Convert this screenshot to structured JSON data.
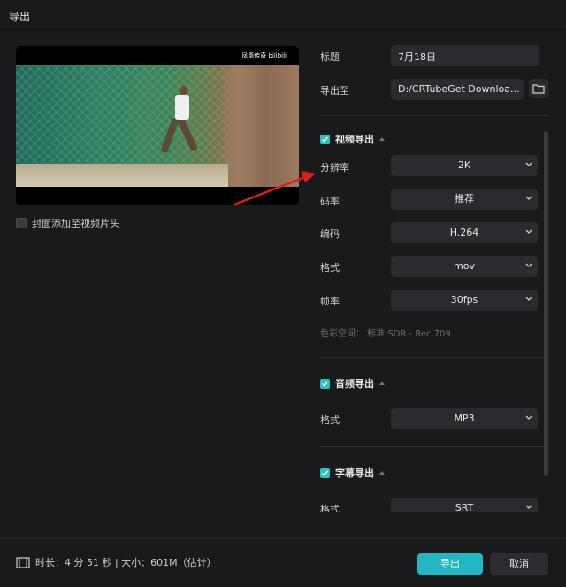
{
  "window": {
    "title": "导出"
  },
  "preview": {
    "watermark": "凤凰传奇 bilibili"
  },
  "cover": {
    "label": "封面添加至视频片头",
    "checked": false
  },
  "fields": {
    "title_label": "标题",
    "title_value": "7月18日",
    "export_to_label": "导出至",
    "export_to_value": "D:/CRTubeGet Downloa..."
  },
  "video": {
    "section_label": "视频导出",
    "checked": true,
    "resolution_label": "分辨率",
    "resolution_value": "2K",
    "bitrate_label": "码率",
    "bitrate_value": "推荐",
    "codec_label": "编码",
    "codec_value": "H.264",
    "format_label": "格式",
    "format_value": "mov",
    "framerate_label": "帧率",
    "framerate_value": "30fps",
    "colorspace_text": "色彩空间：  标准 SDR - Rec.709"
  },
  "audio": {
    "section_label": "音频导出",
    "checked": true,
    "format_label": "格式",
    "format_value": "MP3"
  },
  "subtitle": {
    "section_label": "字幕导出",
    "checked": true,
    "format_label": "格式",
    "format_value": "SRT"
  },
  "footer": {
    "info": "时长：4 分 51 秒 | 大小：601M（估计）",
    "export_button": "导出",
    "cancel_button": "取消"
  },
  "colors": {
    "accent": "#25b6c4",
    "checkbox": "#27c2c2",
    "annotation_arrow": "#e21c1c"
  },
  "icons": [
    "folder-icon",
    "chevron-down-icon",
    "checkbox-icon",
    "film-icon",
    "caret-up-icon"
  ]
}
